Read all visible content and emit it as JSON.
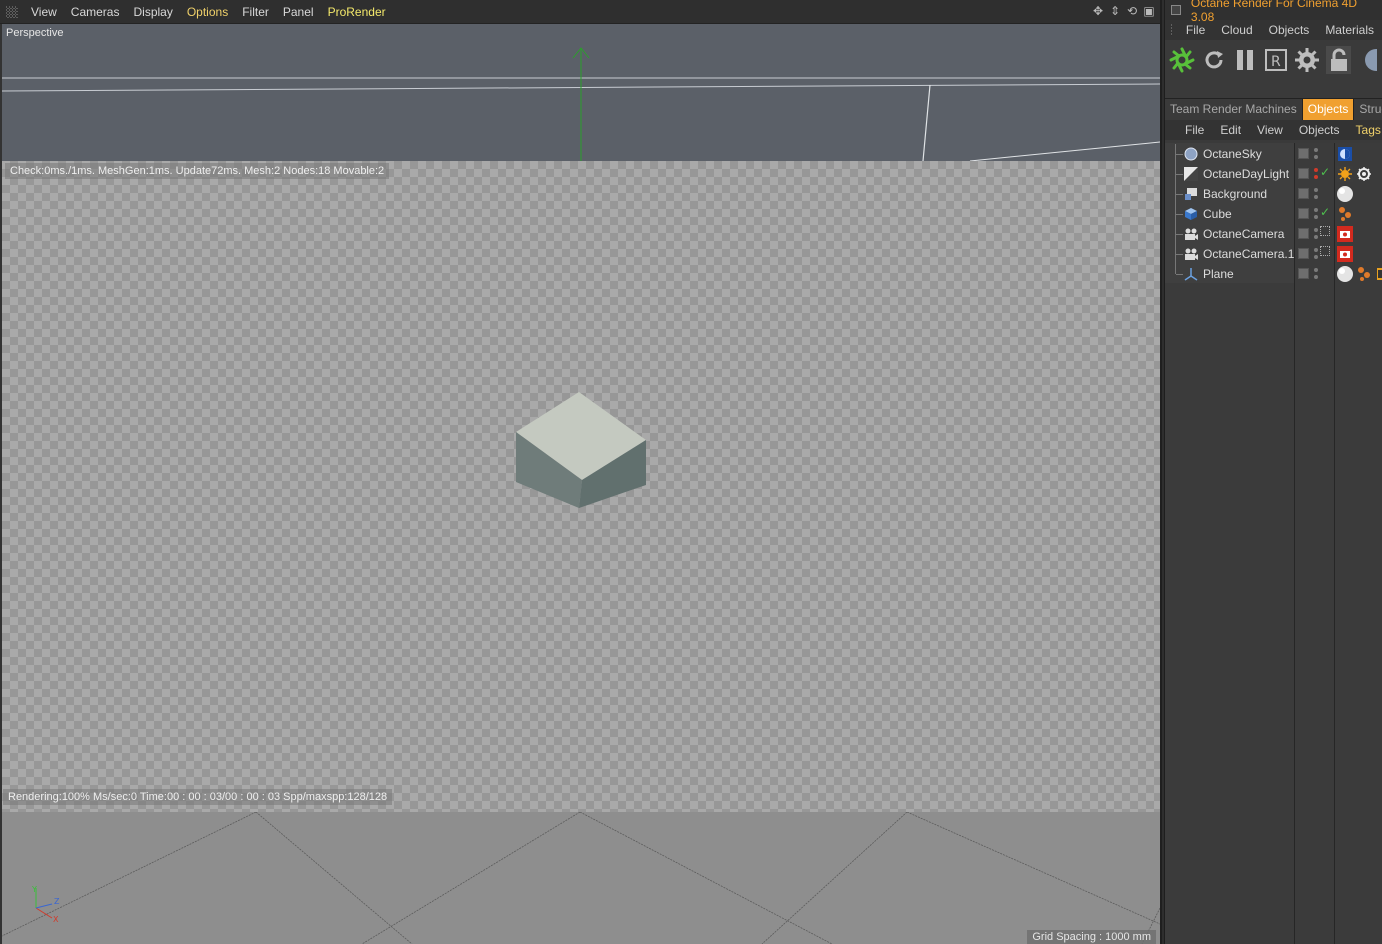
{
  "viewport": {
    "menus": [
      "View",
      "Cameras",
      "Display",
      "Options",
      "Filter",
      "Panel",
      "ProRender"
    ],
    "view_label": "Perspective",
    "stats": "Check:0ms./1ms. MeshGen:1ms. Update72ms. Mesh:2 Nodes:18 Movable:2",
    "render_status": "Rendering:100% Ms/sec:0 Time:00 : 00 : 03/00 : 00 : 03 Spp/maxspp:128/128",
    "grid_spacing": "Grid Spacing : 1000 mm",
    "axis_labels": {
      "x": "X",
      "y": "Y",
      "z": "Z"
    },
    "nav_icons": [
      "move-view-icon",
      "dolly-view-icon",
      "rotate-view-icon",
      "maximize-view-icon"
    ]
  },
  "panel": {
    "title": "Octane Render For Cinema 4D 3.08",
    "menus": [
      "File",
      "Cloud",
      "Objects",
      "Materials"
    ],
    "toolbar_icons": [
      "octane-logo-icon",
      "restart-render-icon",
      "pause-render-icon",
      "r-render-icon",
      "settings-gear-icon",
      "lock-icon",
      "sphere-icon"
    ],
    "tabs": [
      "Team Render Machines",
      "Objects",
      "Struc"
    ],
    "active_tab": "Objects",
    "om_menus": [
      "File",
      "Edit",
      "View",
      "Objects",
      "Tags"
    ],
    "objects": [
      {
        "name": "OctaneSky",
        "icon": "sky-icon",
        "check": false,
        "tags": [
          "octane-env-tag-icon"
        ]
      },
      {
        "name": "OctaneDayLight",
        "icon": "daylight-icon",
        "check": true,
        "tags": [
          "sun-tag-icon",
          "gear-tag-icon"
        ]
      },
      {
        "name": "Background",
        "icon": "background-icon",
        "check": false,
        "tags": [
          "material-tag-icon"
        ]
      },
      {
        "name": "Cube",
        "icon": "cube-icon",
        "check": true,
        "tags": [
          "phong-tag-icon"
        ]
      },
      {
        "name": "OctaneCamera",
        "icon": "camera-icon",
        "check": false,
        "tags": [
          "octane-camera-tag-icon"
        ]
      },
      {
        "name": "OctaneCamera.1",
        "icon": "camera-icon",
        "check": false,
        "tags": [
          "octane-camera-tag-icon"
        ]
      },
      {
        "name": "Plane",
        "icon": "plane-icon",
        "check": false,
        "tags": [
          "material-tag-icon",
          "phong-tag-icon",
          "extra-tag-icon"
        ]
      }
    ]
  }
}
